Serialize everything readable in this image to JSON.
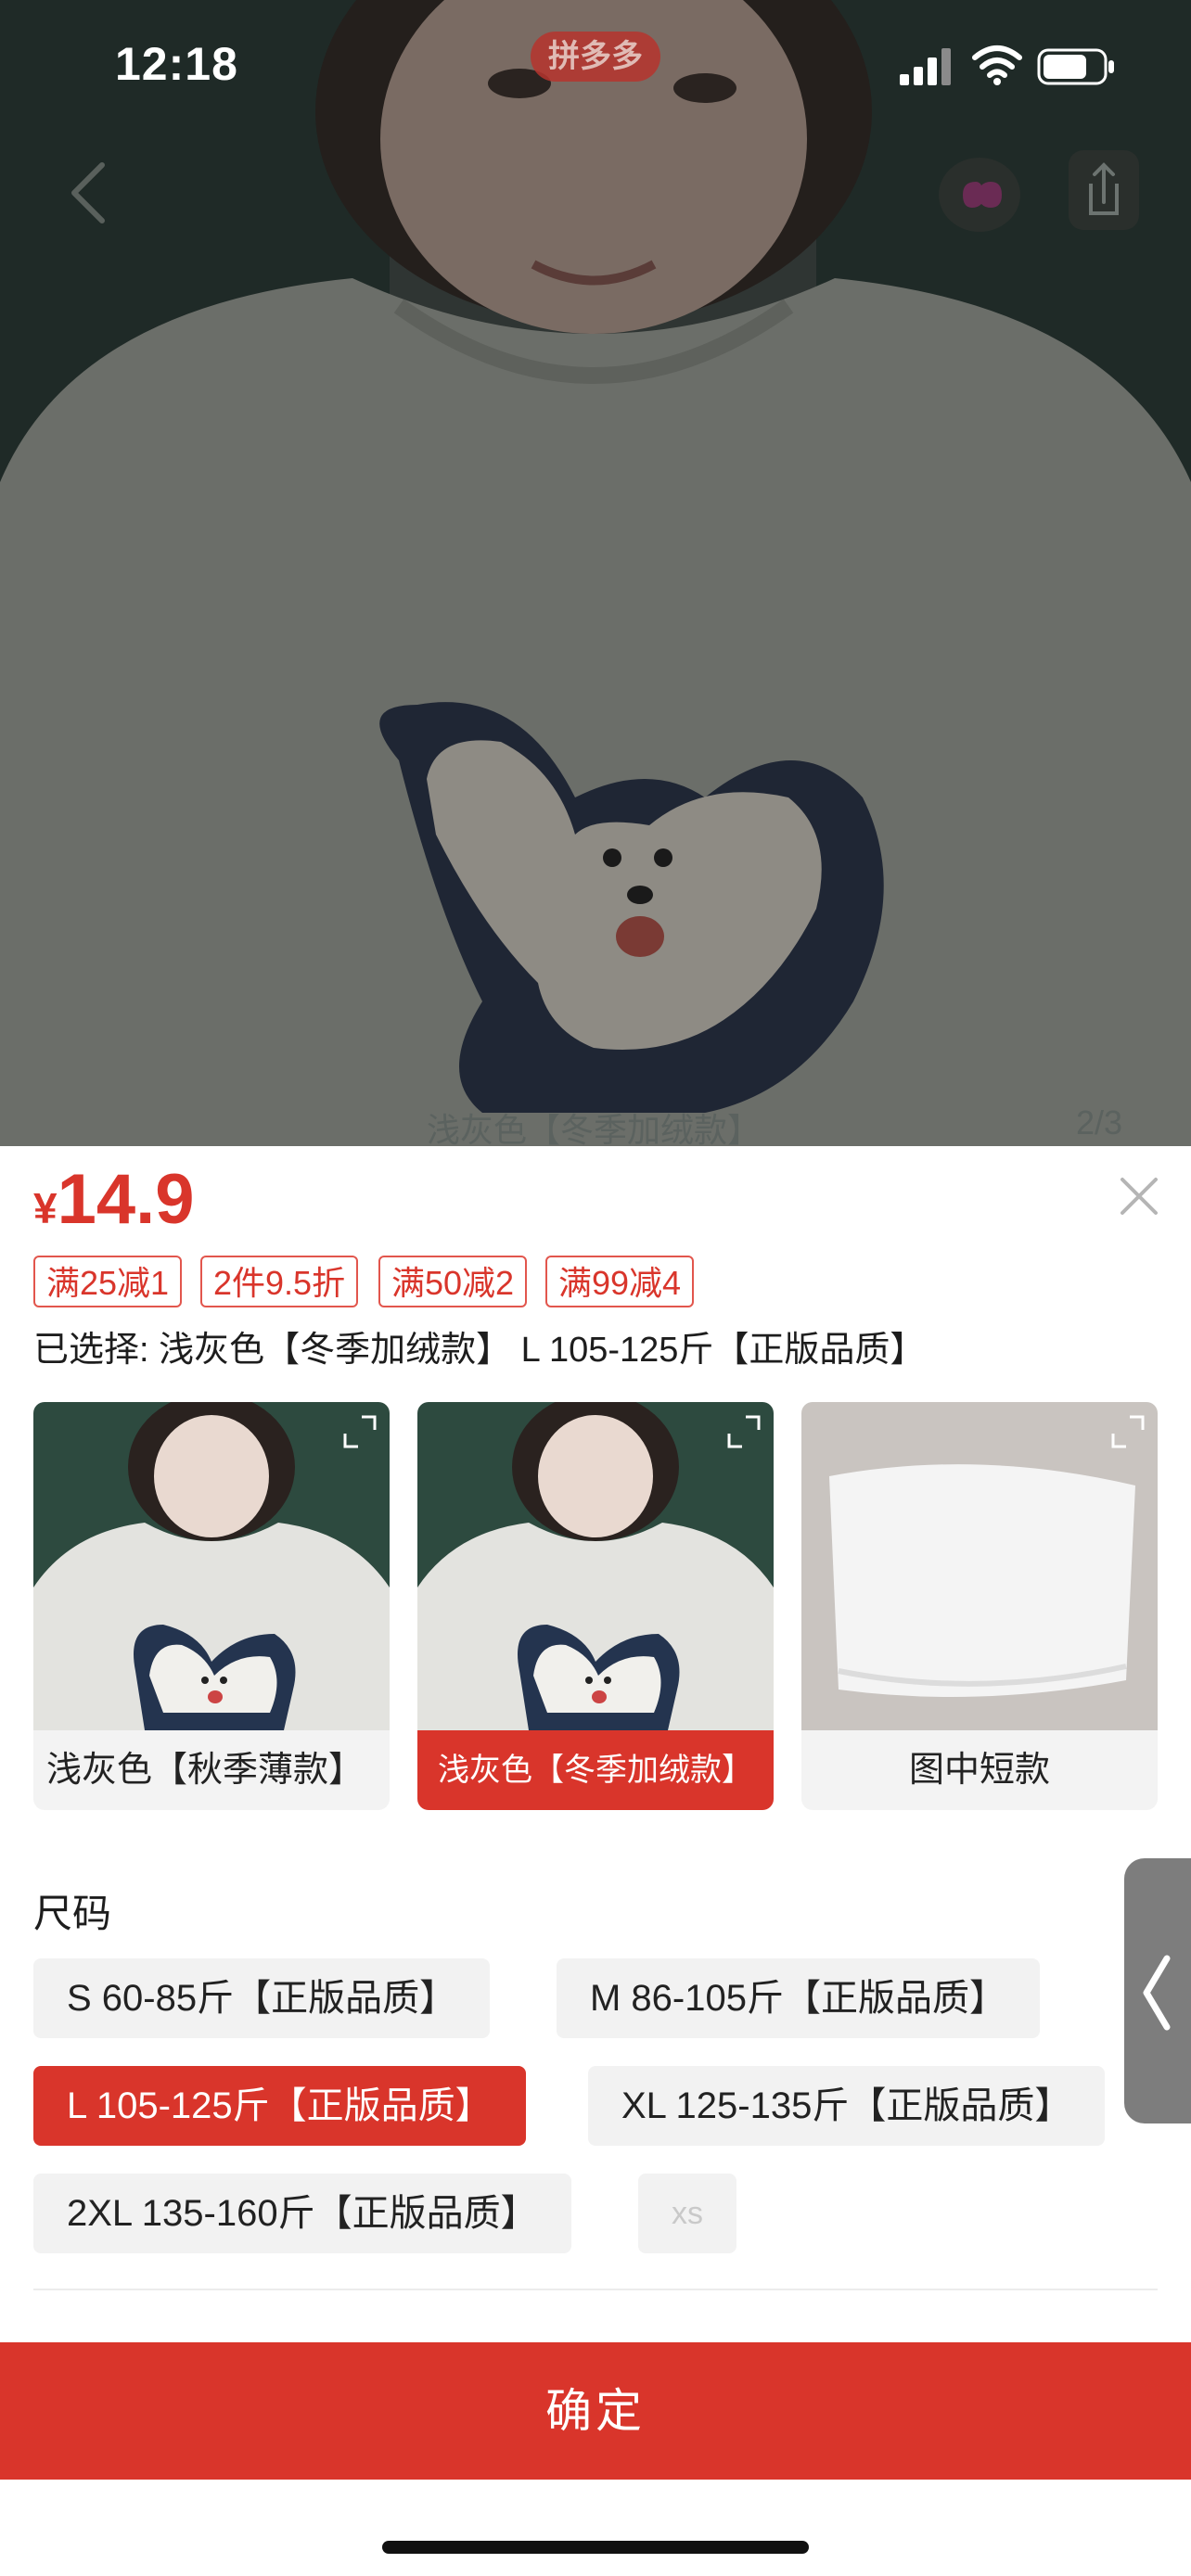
{
  "status_bar": {
    "time": "12:18",
    "app_badge": "拼多多",
    "icons": [
      "signal-icon",
      "wifi-icon",
      "battery-icon"
    ]
  },
  "photo": {
    "caption": "浅灰色【冬季加绒款】",
    "counter": "2/3",
    "icons": [
      "back-icon",
      "app-logo-icon",
      "share-icon"
    ]
  },
  "price": {
    "currency": "¥",
    "amount": "14.9",
    "color": "#d9352b"
  },
  "promotions": [
    "满25减1",
    "2件9.5折",
    "满50减2",
    "满99减4"
  ],
  "selected_text": "已选择: 浅灰色【冬季加绒款】 L 105-125斤【正版品质】",
  "variants": [
    {
      "label": "浅灰色【秋季薄款】",
      "selected": false
    },
    {
      "label": "浅灰色【冬季加绒款】",
      "selected": true
    },
    {
      "label": "图中短款",
      "selected": false
    }
  ],
  "size_section": {
    "heading": "尺码",
    "options": [
      {
        "label": "S 60-85斤【正版品质】",
        "state": "normal"
      },
      {
        "label": "M 86-105斤【正版品质】",
        "state": "normal"
      },
      {
        "label": "L 105-125斤【正版品质】",
        "state": "selected"
      },
      {
        "label": "XL 125-135斤【正版品质】",
        "state": "normal"
      },
      {
        "label": "2XL 135-160斤【正版品质】",
        "state": "normal"
      },
      {
        "label": "xs",
        "state": "disabled"
      }
    ]
  },
  "confirm_button": "确定",
  "colors": {
    "accent": "#d9352b",
    "chip_bg": "#f2f2f2"
  }
}
